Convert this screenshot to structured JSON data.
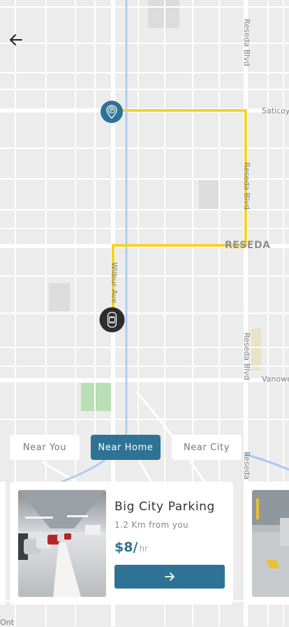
{
  "map": {
    "labels": {
      "reseda_blvd_top": "Reseda Blvd",
      "saticoy": "Saticoy",
      "reseda_blvd_mid": "Reseda Blvd",
      "reseda_district": "RESEDA",
      "wilbur": "Wilbur Ave",
      "reseda_blvd_low": "Reseda Blvd",
      "vanowen": "Vanowe",
      "reseda_blvd_bottom": "Reseda",
      "bottom_left": "Ont"
    },
    "colors": {
      "route": "#f4d231",
      "marker": "#2e7396",
      "car_marker": "#2d2d2d",
      "water": "#a8c8f0",
      "park": "#b9dfb4"
    }
  },
  "header": {
    "back_icon": "arrow-left-icon"
  },
  "tabs": [
    {
      "label": "Near You",
      "active": false
    },
    {
      "label": "Near Home",
      "active": true
    },
    {
      "label": "Near City",
      "active": false
    }
  ],
  "cards": [
    {
      "title": "Big City Parking",
      "distance": "1.2 Km from you",
      "price": "$8/",
      "price_unit": "hr",
      "button_icon": "arrow-right-icon"
    }
  ]
}
